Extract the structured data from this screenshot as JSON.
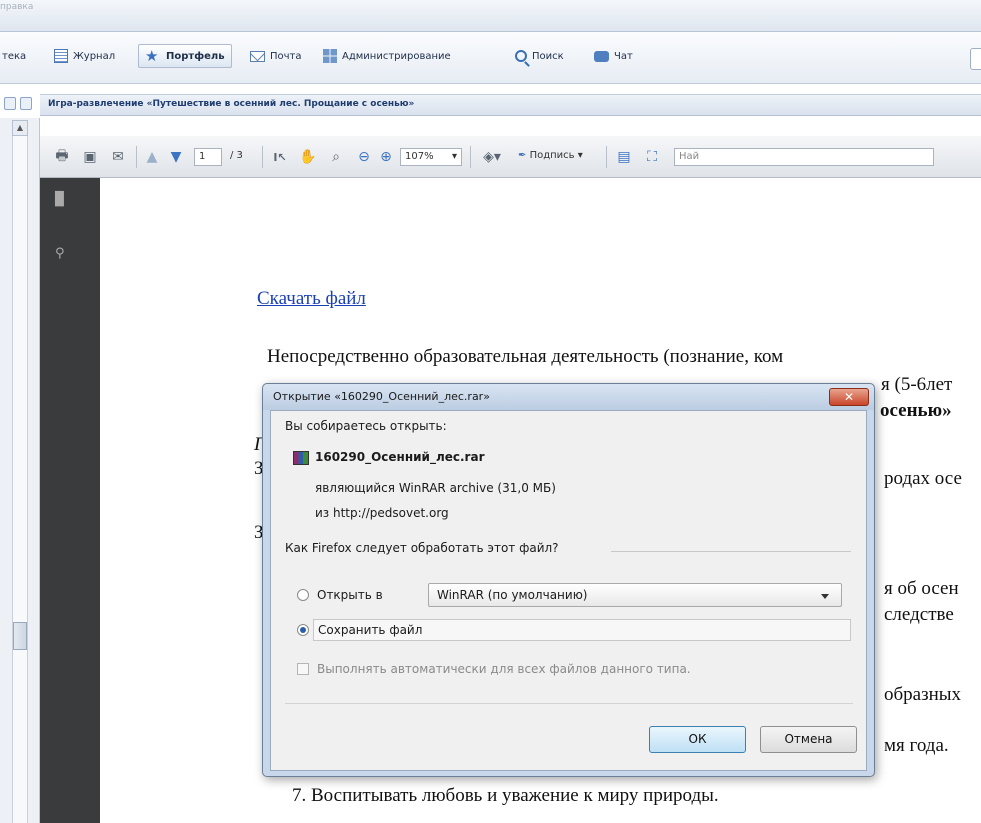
{
  "app": {
    "top_title": "правка"
  },
  "nav": {
    "cut_left": "тека",
    "items": [
      {
        "label": "Журнал",
        "icon": "journal-icon"
      },
      {
        "label": "Портфель",
        "icon": "star-icon",
        "active": true
      },
      {
        "label": "Почта",
        "icon": "mail-icon"
      },
      {
        "label": "Администрирование",
        "icon": "admin-icon"
      },
      {
        "label": "Поиск",
        "icon": "search-icon"
      },
      {
        "label": "Чат",
        "icon": "chat-icon"
      }
    ]
  },
  "breadcrumb": "Игра-развлечение «Путешествие в осенний лес. Прощание с осенью»",
  "pdf_toolbar": {
    "page_current": "1",
    "page_total": "/ 3",
    "zoom": "107%",
    "sign_label": "Подпись",
    "find_placeholder": "Най"
  },
  "document": {
    "link": "Скачать файл",
    "lines": [
      "Непосредственно образовательная деятельность (познание, ком",
      "я (5-6лет",
      "осенью»",
      "Г",
      "З",
      "родах осе",
      "З",
      "я об осен",
      "следстве",
      "образных",
      "мя года.",
      "7.  Воспитывать любовь и уважение к миру природы."
    ]
  },
  "dialog": {
    "title": "Открытие «160290_Осенний_лес.rar»",
    "close_label": "✕",
    "intro": "Вы собираетесь открыть:",
    "filename": "160290_Осенний_лес.rar",
    "type_line": "являющийся  WinRAR archive (31,0 МБ)",
    "source_line": "из http://pedsovet.org",
    "question": "Как Firefox следует обработать этот файл?",
    "open_with_label": "Открыть в",
    "open_with_value": "WinRAR (по умолчанию)",
    "save_label": "Сохранить файл",
    "save_selected": true,
    "auto_label": "Выполнять автоматически для всех файлов данного типа.",
    "ok_label": "ОК",
    "cancel_label": "Отмена"
  }
}
